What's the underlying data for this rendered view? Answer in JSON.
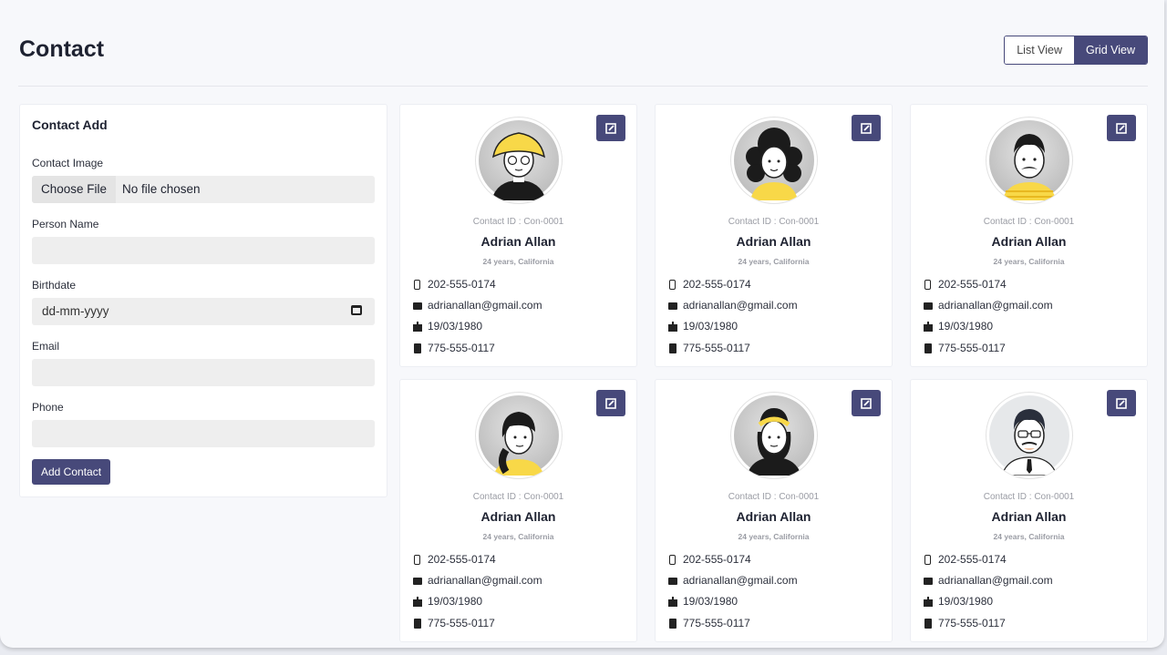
{
  "page": {
    "title": "Contact"
  },
  "view_toggle": {
    "list_label": "List View",
    "grid_label": "Grid View",
    "active": "grid"
  },
  "form": {
    "title": "Contact Add",
    "image_label": "Contact Image",
    "file_button": "Choose File",
    "file_status": "No file chosen",
    "name_label": "Person Name",
    "name_value": "",
    "birthdate_label": "Birthdate",
    "birthdate_placeholder": "dd-mm-yyyy",
    "email_label": "Email",
    "email_value": "",
    "phone_label": "Phone",
    "phone_value": "",
    "submit_label": "Add Contact"
  },
  "contacts": [
    {
      "id_text": "Contact ID : Con-0001",
      "name": "Adrian Allan",
      "meta": "24 years, California",
      "phone": "202-555-0174",
      "email": "adrianallan@gmail.com",
      "birthdate": "19/03/1980",
      "alt_phone": "775-555-0117",
      "avatar": "yellow-hat-woman"
    },
    {
      "id_text": "Contact ID : Con-0001",
      "name": "Adrian Allan",
      "meta": "24 years, California",
      "phone": "202-555-0174",
      "email": "adrianallan@gmail.com",
      "birthdate": "19/03/1980",
      "alt_phone": "775-555-0117",
      "avatar": "curly-hair-woman"
    },
    {
      "id_text": "Contact ID : Con-0001",
      "name": "Adrian Allan",
      "meta": "24 years, California",
      "phone": "202-555-0174",
      "email": "adrianallan@gmail.com",
      "birthdate": "19/03/1980",
      "alt_phone": "775-555-0117",
      "avatar": "mustache-man"
    },
    {
      "id_text": "Contact ID : Con-0001",
      "name": "Adrian Allan",
      "meta": "24 years, California",
      "phone": "202-555-0174",
      "email": "adrianallan@gmail.com",
      "birthdate": "19/03/1980",
      "alt_phone": "775-555-0117",
      "avatar": "ponytail-woman"
    },
    {
      "id_text": "Contact ID : Con-0001",
      "name": "Adrian Allan",
      "meta": "24 years, California",
      "phone": "202-555-0174",
      "email": "adrianallan@gmail.com",
      "birthdate": "19/03/1980",
      "alt_phone": "775-555-0117",
      "avatar": "headband-man"
    },
    {
      "id_text": "Contact ID : Con-0001",
      "name": "Adrian Allan",
      "meta": "24 years, California",
      "phone": "202-555-0174",
      "email": "adrianallan@gmail.com",
      "birthdate": "19/03/1980",
      "alt_phone": "775-555-0117",
      "avatar": "glasses-tie-man"
    }
  ],
  "colors": {
    "accent": "#47497a",
    "avatar_yellow": "#f8d848",
    "background": "#f7f8fb"
  }
}
